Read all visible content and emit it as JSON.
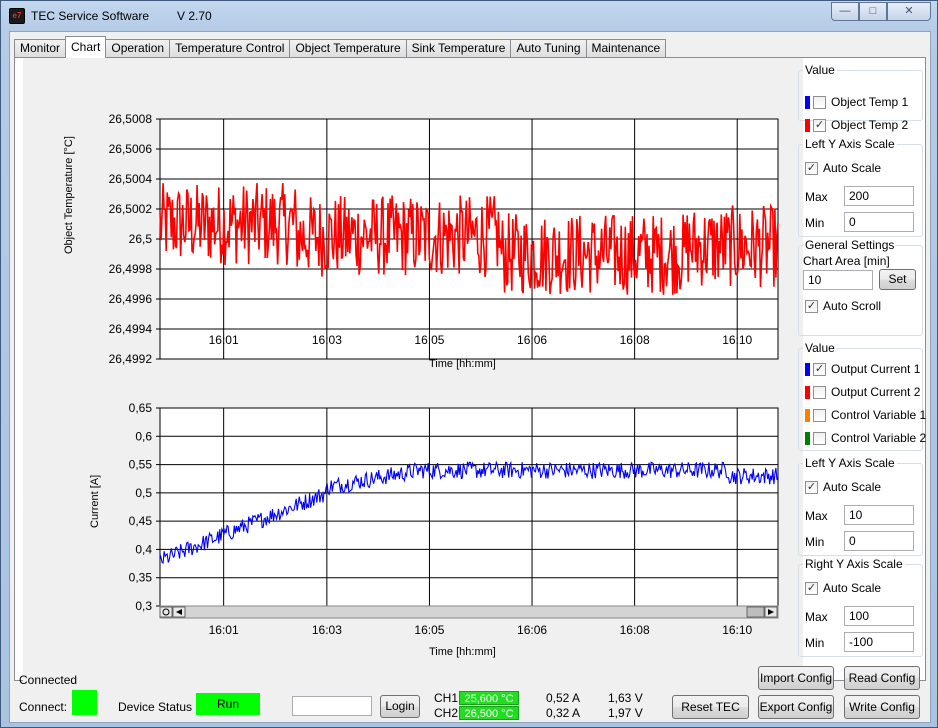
{
  "window": {
    "title": "TEC Service Software",
    "version": "V 2.70",
    "icon_text": "e7",
    "minimize": "—",
    "maximize": "□",
    "close": "✕"
  },
  "tabs": [
    "Monitor",
    "Chart",
    "Operation",
    "Temperature Control",
    "Object Temperature",
    "Sink Temperature",
    "Auto Tuning",
    "Maintenance"
  ],
  "active_tab": "Chart",
  "chart_data": [
    {
      "type": "line",
      "title": "",
      "xlabel": "Time [hh:mm]",
      "ylabel": "Object Temperature [°C]",
      "x_ticks": [
        "16:01",
        "16:03",
        "16:05",
        "16:06",
        "16:08",
        "16:10"
      ],
      "y_ticks": [
        "26,4992",
        "26,4994",
        "26,4996",
        "26,4998",
        "26,5",
        "26,5002",
        "26,5004",
        "26,5006",
        "26,5008"
      ],
      "ylim": [
        26.4992,
        26.5008
      ],
      "grid": true,
      "series": [
        {
          "name": "Object Temp 2",
          "color": "#ff0000",
          "values_summary": "noisy signal oscillating around 26.4999–26.5001, range approx 26.49955 to 26.50045"
        }
      ]
    },
    {
      "type": "line",
      "title": "",
      "xlabel": "Time [hh:mm]",
      "ylabel": "Current [A]",
      "x_ticks": [
        "16:01",
        "16:03",
        "16:05",
        "16:06",
        "16:08",
        "16:10"
      ],
      "y_ticks": [
        "0,3",
        "0,35",
        "0,4",
        "0,45",
        "0,5",
        "0,55",
        "0,6",
        "0,65"
      ],
      "ylim": [
        0.3,
        0.65
      ],
      "grid": true,
      "series": [
        {
          "name": "Output Current 1",
          "color": "#0000ff",
          "values_summary": "rises from ~0.38 at start to ~0.50 near 16:03, then ~0.54 plateau through 16:10, ending ~0.52"
        }
      ]
    }
  ],
  "panel_top": {
    "value_group": "Value",
    "items": [
      {
        "label": "Object Temp 1",
        "checked": false,
        "color": "#0000ff"
      },
      {
        "label": "Object Temp 2",
        "checked": true,
        "color": "#ff0000"
      }
    ],
    "left_axis": {
      "title": "Left Y Axis Scale",
      "auto_scale_label": "Auto Scale",
      "max_label": "Max",
      "max_value": "200",
      "min_label": "Min",
      "min_value": "0"
    },
    "general": {
      "title": "General Settings",
      "chart_area_label": "Chart Area [min]",
      "chart_area_value": "10",
      "set_button": "Set",
      "auto_scroll_label": "Auto Scroll"
    }
  },
  "panel_bottom": {
    "value_group": "Value",
    "items": [
      {
        "label": "Output Current 1",
        "checked": true,
        "color": "#0000ff"
      },
      {
        "label": "Output Current 2",
        "checked": false,
        "color": "#ff0000"
      },
      {
        "label": "Control Variable 1",
        "checked": false,
        "color": "#ff8000"
      },
      {
        "label": "Control Variable 2",
        "checked": false,
        "color": "#008000"
      }
    ],
    "left_axis": {
      "title": "Left Y Axis Scale",
      "auto_scale_label": "Auto Scale",
      "max_label": "Max",
      "max_value": "10",
      "min_label": "Min",
      "min_value": "0"
    },
    "right_axis": {
      "title": "Right Y Axis Scale",
      "auto_scale_label": "Auto Scale",
      "max_label": "Max",
      "max_value": "100",
      "min_label": "Min",
      "min_value": "-100"
    }
  },
  "statusbar": {
    "connected_text": "Connected",
    "connect_label": "Connect:",
    "device_status_label": "Device Status",
    "device_status_value": "Run",
    "login_input_value": "",
    "login_button": "Login",
    "ch1_label": "CH1",
    "ch1_temp": "25,600 °C",
    "ch1_current": "0,52 A",
    "ch1_voltage": "1,63 V",
    "ch2_label": "CH2",
    "ch2_temp": "26,500 °C",
    "ch2_current": "0,32 A",
    "ch2_voltage": "1,97 V",
    "reset_tec": "Reset TEC",
    "import_config": "Import Config",
    "export_config": "Export Config",
    "read_config": "Read Config",
    "write_config": "Write Config",
    "status_color": "#00ff00"
  }
}
